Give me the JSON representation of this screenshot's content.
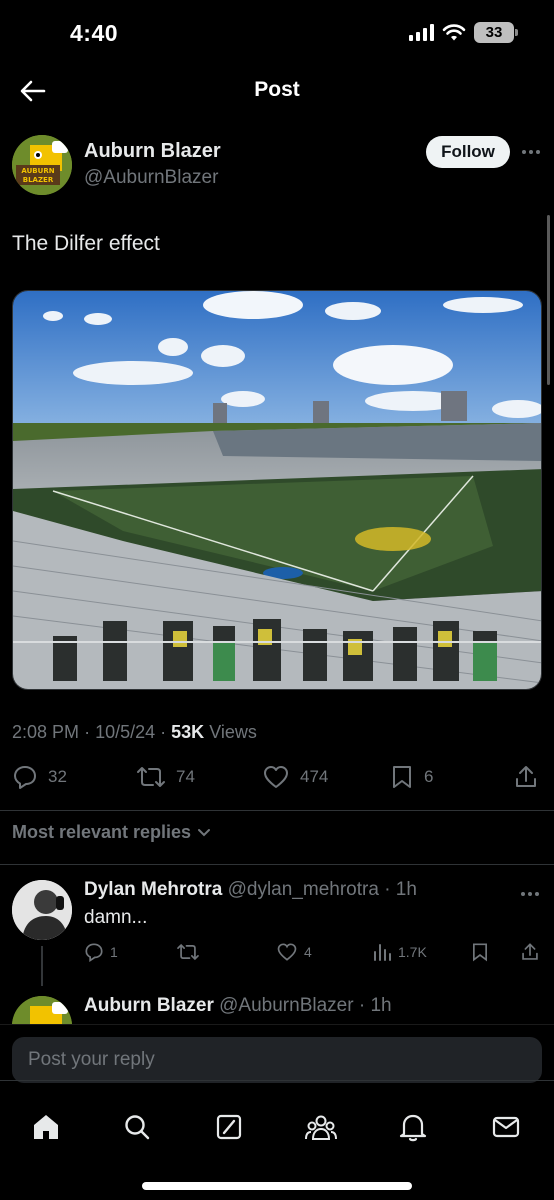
{
  "status": {
    "time": "4:40",
    "battery": "33"
  },
  "nav": {
    "title": "Post"
  },
  "post": {
    "author_name": "Auburn Blazer",
    "author_handle": "@AuburnBlazer",
    "follow_label": "Follow",
    "text": "The Dilfer effect",
    "media_icon": "stadium-photo",
    "time": "2:08 PM",
    "date": "10/5/24",
    "views_count": "53K",
    "views_label": "Views",
    "replies": "32",
    "reposts": "74",
    "likes": "474",
    "bookmarks": "6"
  },
  "avatar_text": {
    "line1": "AUBURN",
    "line2": "BLAZER"
  },
  "sort": {
    "label": "Most relevant replies"
  },
  "replies": [
    {
      "name": "Dylan Mehrotra",
      "handle": "@dylan_mehrotra",
      "time": "1h",
      "text": "damn...",
      "replies": "1",
      "likes": "4",
      "views": "1.7K"
    },
    {
      "name": "Auburn Blazer",
      "handle": "@AuburnBlazer",
      "time": "1h"
    }
  ],
  "compose": {
    "placeholder": "Post your reply"
  },
  "colors": {
    "background": "#000000",
    "text": "#e7e9ea",
    "muted": "#71767b",
    "accent": "#1d9bf0"
  },
  "tabs": [
    "home-icon",
    "search-icon",
    "grok-icon",
    "communities-icon",
    "notifications-icon",
    "messages-icon"
  ]
}
